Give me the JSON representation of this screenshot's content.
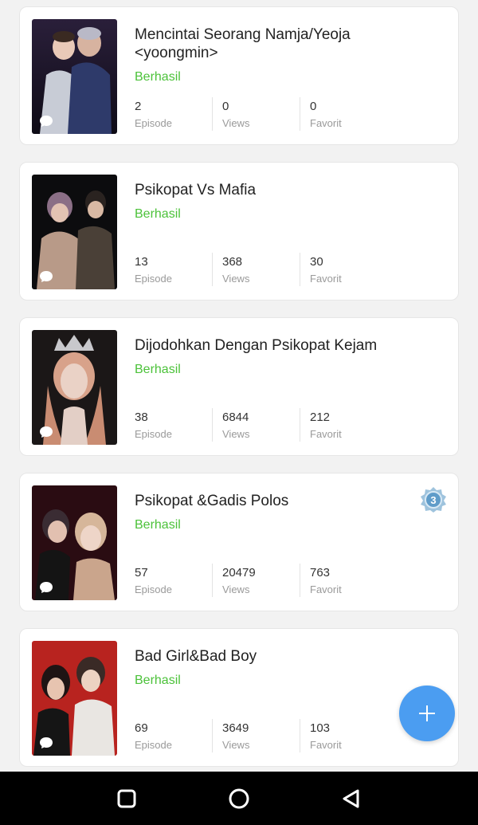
{
  "stories": [
    {
      "title": "Mencintai Seorang Namja/Yeoja <yoongmin>",
      "status": "Berhasil",
      "episodes": "2",
      "episode_label": "Episode",
      "views": "0",
      "views_label": "Views",
      "favorites": "0",
      "favorites_label": "Favorit"
    },
    {
      "title": "Psikopat Vs Mafia",
      "status": "Berhasil",
      "episodes": "13",
      "episode_label": "Episode",
      "views": "368",
      "views_label": "Views",
      "favorites": "30",
      "favorites_label": "Favorit"
    },
    {
      "title": "Dijodohkan Dengan Psikopat Kejam",
      "status": "Berhasil",
      "episodes": "38",
      "episode_label": "Episode",
      "views": "6844",
      "views_label": "Views",
      "favorites": "212",
      "favorites_label": "Favorit"
    },
    {
      "title": "Psikopat &Gadis Polos",
      "status": "Berhasil",
      "episodes": "57",
      "episode_label": "Episode",
      "views": "20479",
      "views_label": "Views",
      "favorites": "763",
      "favorites_label": "Favorit",
      "rank_badge": "3"
    },
    {
      "title": "Bad Girl&Bad Boy",
      "status": "Berhasil",
      "episodes": "69",
      "episode_label": "Episode",
      "views": "3649",
      "views_label": "Views",
      "favorites": "103",
      "favorites_label": "Favorit"
    }
  ],
  "fab": {
    "icon": "plus-icon"
  },
  "nav": {
    "icons": [
      "recent-apps-icon",
      "home-icon",
      "back-icon"
    ]
  },
  "colors": {
    "status": "#4cc23a",
    "fab": "#4b9df1",
    "navbar": "#000000"
  }
}
